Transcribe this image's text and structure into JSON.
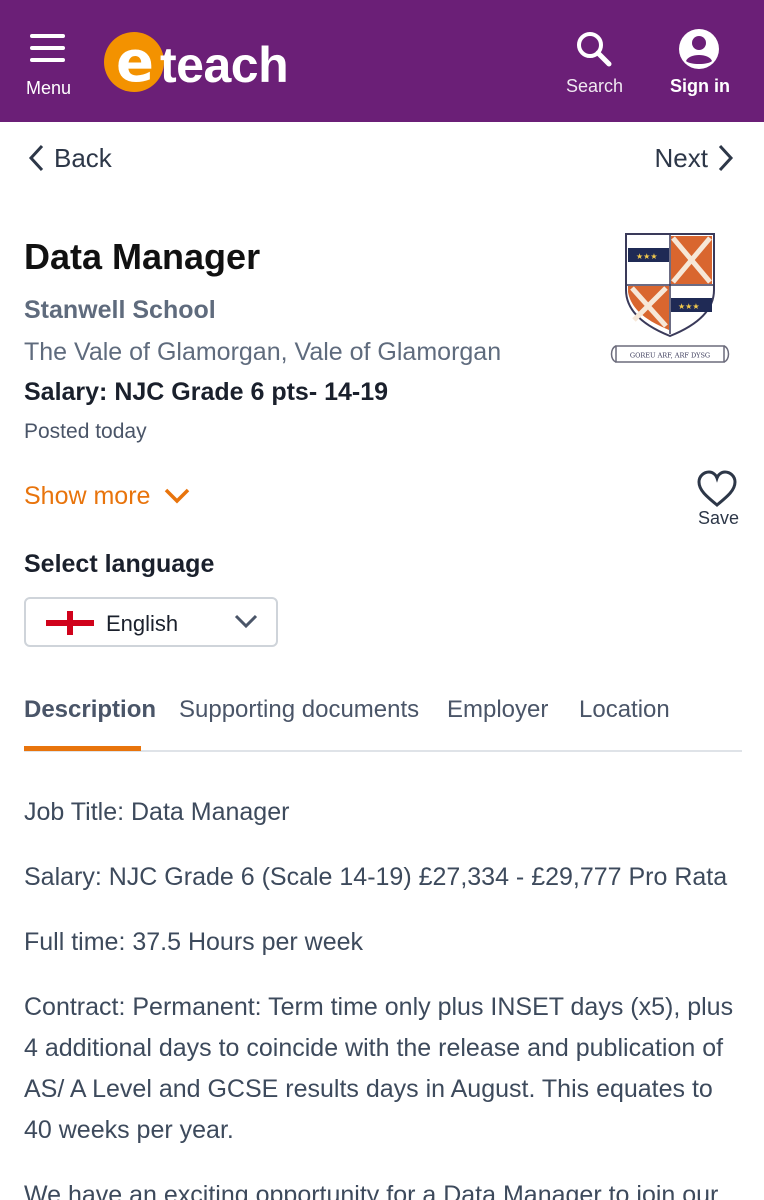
{
  "header": {
    "menu_label": "Menu",
    "logo_letter": "e",
    "logo_rest": "teach",
    "search_label": "Search",
    "signin_label": "Sign in",
    "bg_color": "#6b1f77",
    "logo_color": "#f39200"
  },
  "nav": {
    "back_label": "Back",
    "next_label": "Next"
  },
  "job": {
    "title": "Data Manager",
    "employer": "Stanwell School",
    "location": "The Vale of Glamorgan, Vale of Glamorgan",
    "salary": "Salary: NJC Grade 6 pts- 14-19",
    "posted": "Posted today",
    "show_more": "Show more",
    "save_label": "Save",
    "crest_motto": "GOREU ARF, ARF DYSG"
  },
  "language": {
    "label": "Select language",
    "selected": "English"
  },
  "tabs": [
    {
      "label": "Description",
      "active": true
    },
    {
      "label": "Supporting documents",
      "active": false
    },
    {
      "label": "Employer",
      "active": false
    },
    {
      "label": "Location",
      "active": false
    }
  ],
  "description": {
    "p1": "Job Title: Data Manager",
    "p2": "Salary: NJC Grade 6 (Scale 14-19) £27,334 - £29,777 Pro Rata",
    "p3": "Full time: 37.5 Hours per week",
    "p4": "Contract: Permanent: Term time only plus INSET days (x5), plus 4 additional days to coincide with the release and publication of AS/ A Level and GCSE results days in August. This equates to 40 weeks per year.",
    "p5": "We have an exciting opportunity for a Data Manager to join our"
  },
  "accent_color": "#e8740c"
}
